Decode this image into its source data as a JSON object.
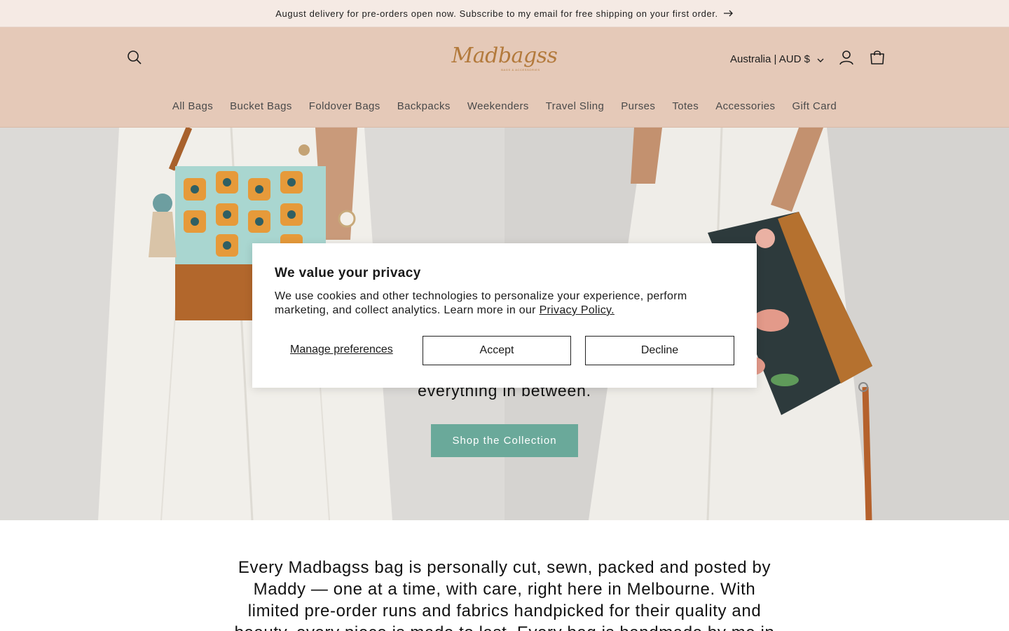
{
  "announcement": {
    "text": "August delivery for pre-orders open now. Subscribe to my email for free shipping on your first order.",
    "arrow_icon": "arrow-right-icon"
  },
  "header": {
    "logo_text": "Madbagss",
    "logo_tagline": "BAGS & ACCESSORIES",
    "country_selector": "Australia | AUD $",
    "icons": {
      "search": "search-icon",
      "account": "account-icon",
      "cart": "cart-icon",
      "chevron": "chevron-down-icon"
    }
  },
  "nav": {
    "items": [
      {
        "label": "All Bags"
      },
      {
        "label": "Bucket Bags"
      },
      {
        "label": "Foldover Bags"
      },
      {
        "label": "Backpacks"
      },
      {
        "label": "Weekenders"
      },
      {
        "label": "Travel Sling"
      },
      {
        "label": "Purses"
      },
      {
        "label": "Totes"
      },
      {
        "label": "Accessories"
      },
      {
        "label": "Gift Card"
      }
    ]
  },
  "hero": {
    "subtitle": "everything in between.",
    "cta_label": "Shop the Collection",
    "cta_color": "#6aa99a"
  },
  "intro": {
    "text": "Every Madbagss bag is personally cut, sewn, packed and posted by Maddy — one at a time, with care, right here in Melbourne. With limited pre-order runs and fabrics handpicked for their quality and beauty, every piece is made to last. Every bag is handmade by me in"
  },
  "privacy_modal": {
    "title": "We value your privacy",
    "body": "We use cookies and other technologies to personalize your experience, perform marketing, and collect analytics. Learn more in our",
    "policy_link": "Privacy Policy.",
    "manage_label": "Manage preferences",
    "accept_label": "Accept",
    "decline_label": "Decline"
  },
  "colors": {
    "announcement_bg": "#f5eae4",
    "header_bg": "#e5c9b8",
    "brand_logo": "#b37a3c",
    "accent": "#6aa99a"
  }
}
